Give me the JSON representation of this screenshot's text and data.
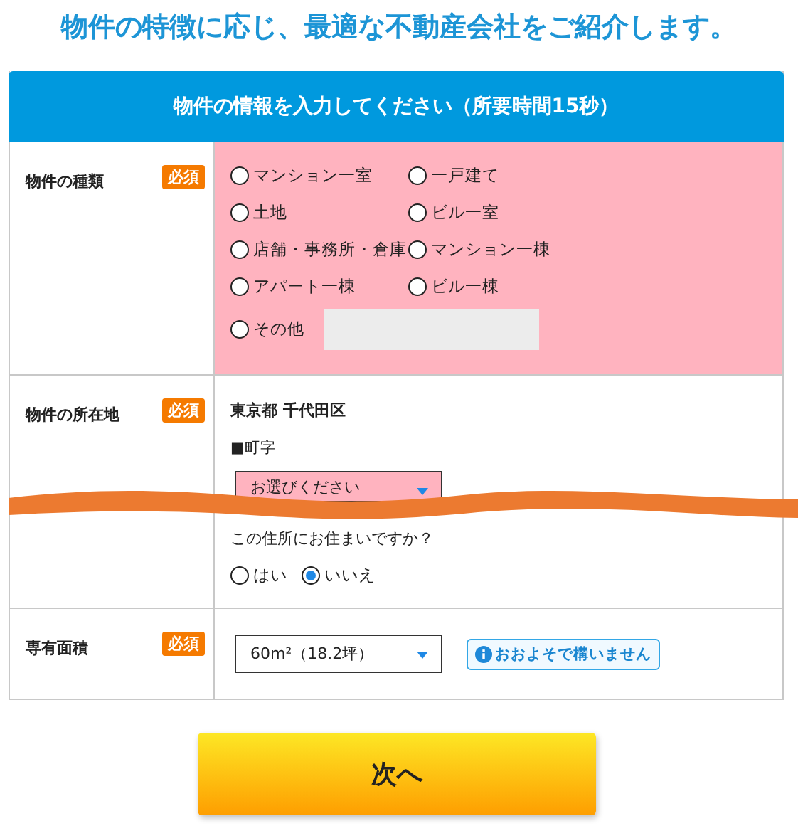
{
  "title": "物件の特徴に応じ、最適な不動産会社をご紹介します。",
  "form": {
    "header": "物件の情報を入力してください（所要時間15秒）",
    "rows": [
      {
        "kind": "type",
        "label": "物件の種類",
        "badge": "必須",
        "options": [
          {
            "label": "マンション一室",
            "selected": false
          },
          {
            "label": "一戸建て",
            "selected": false
          },
          {
            "label": "土地",
            "selected": false
          },
          {
            "label": "ビル一室",
            "selected": false
          },
          {
            "label": "店舗・事務所・倉庫",
            "selected": false
          },
          {
            "label": "マンション一棟",
            "selected": false
          },
          {
            "label": "アパート一棟",
            "selected": false
          },
          {
            "label": "ビル一棟",
            "selected": false
          }
        ],
        "other": {
          "label": "その他",
          "selected": false
        }
      },
      {
        "kind": "location",
        "label": "物件の所在地",
        "badge": "必須",
        "address": "東京都 千代田区",
        "sublabel": "■町字",
        "select": "お選びください",
        "question": "この住所にお住まいですか？",
        "answers": [
          {
            "label": "はい",
            "selected": false
          },
          {
            "label": "いいえ",
            "selected": true
          }
        ]
      },
      {
        "kind": "area",
        "label": "専有面積",
        "badge": "必須",
        "select": "60m²（18.2坪）",
        "hint": "おおよそで構いません"
      }
    ]
  },
  "next": "次へ"
}
